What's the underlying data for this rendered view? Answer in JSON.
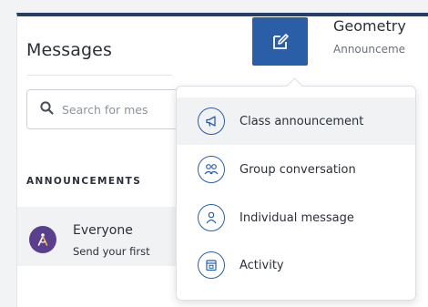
{
  "colors": {
    "header_bar": "#253e6a",
    "accent_blue": "#2a5fa8",
    "avatar_purple": "#5a3f8f",
    "hover_bg": "#f1f2f4"
  },
  "messages": {
    "title": "Messages",
    "compose_icon": "edit-pencil-icon"
  },
  "thread": {
    "title": "Geometry",
    "subtitle": "Announceme"
  },
  "search": {
    "placeholder": "Search for mes",
    "icon": "search-icon"
  },
  "announcements": {
    "section_label": "ANNOUNCEMENTS",
    "items": [
      {
        "name": "Everyone",
        "preview": "Send your first",
        "avatar_icon": "compass-icon"
      }
    ]
  },
  "new_message_menu": {
    "items": [
      {
        "label": "Class announcement",
        "icon": "megaphone-icon",
        "highlighted": true
      },
      {
        "label": "Group conversation",
        "icon": "people-icon",
        "highlighted": false
      },
      {
        "label": "Individual message",
        "icon": "person-icon",
        "highlighted": false
      },
      {
        "label": "Activity",
        "icon": "activity-card-icon",
        "highlighted": false
      }
    ]
  }
}
